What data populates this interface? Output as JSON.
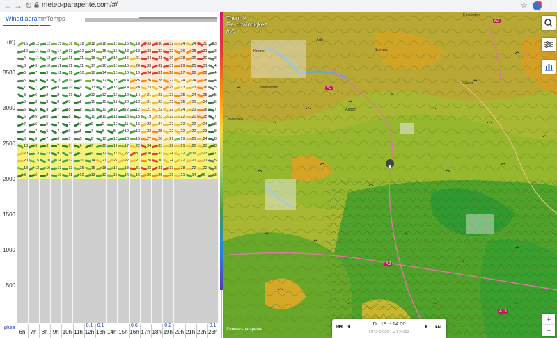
{
  "browser": {
    "url": "meteo-parapente.com/#/"
  },
  "tabs": [
    {
      "label": "Winddiagramm"
    },
    {
      "label": "Temps"
    }
  ],
  "yaxis": {
    "unit": "(m)",
    "labels": [
      "3500",
      "3000",
      "2500",
      "2000",
      "1500",
      "1000",
      "500"
    ]
  },
  "hours": [
    "6h",
    "7h",
    "8h",
    "9h",
    "10h",
    "11h",
    "12h",
    "13h",
    "14h",
    "15h",
    "16h",
    "17h",
    "18h",
    "19h",
    "20h",
    "21h",
    "22h",
    "23h"
  ],
  "rain": {
    "label": "pluie",
    "values": [
      "",
      "",
      "",
      "",
      "",
      "",
      "0.1",
      "0.1",
      "",
      "",
      "0.6",
      "",
      "",
      "0.2",
      "",
      "",
      "",
      "0.1"
    ]
  },
  "speed_rows": [
    [
      "16",
      "12",
      "12",
      "15",
      "18",
      "18",
      "18",
      "18",
      "16",
      "15",
      "18",
      "33",
      "30",
      "32",
      "24",
      "24",
      "30",
      "3"
    ],
    [
      "12",
      "11",
      "12",
      "14",
      "13",
      "12",
      "14",
      "15",
      "16",
      "13",
      "18",
      "33",
      "32",
      "32",
      "26",
      "28",
      "31",
      "3"
    ],
    [
      "4",
      "11",
      "12",
      "12",
      "15",
      "11",
      "18",
      "17",
      "14",
      "16",
      "21",
      "34",
      "31",
      "30",
      "28",
      "26",
      "30",
      "3"
    ],
    [
      "3",
      "9",
      "10",
      "11",
      "11",
      "11",
      "17",
      "16",
      "15",
      "15",
      "20",
      "33",
      "32",
      "31",
      "29",
      "25",
      "31",
      "4"
    ],
    [
      "6",
      "7",
      "9",
      "11",
      "11",
      "10",
      "16",
      "14",
      "15",
      "16",
      "19",
      "34",
      "31",
      "28",
      "27",
      "26",
      "29",
      "4"
    ],
    [
      "5",
      "8",
      "8",
      "10",
      "10",
      "9",
      "16",
      "12",
      "13",
      "14",
      "25",
      "26",
      "28",
      "27",
      "24",
      "24",
      "28",
      "4"
    ],
    [
      "7",
      "7",
      "9",
      "9",
      "10",
      "9",
      "13",
      "11",
      "13",
      "14",
      "20",
      "23",
      "24",
      "25",
      "23",
      "23",
      "26",
      "5"
    ],
    [
      "8",
      "6",
      "9",
      "8",
      "10",
      "8",
      "12",
      "12",
      "12",
      "12",
      "14",
      "21",
      "23",
      "23",
      "25",
      "24",
      "25",
      "5"
    ],
    [
      "9",
      "8",
      "8",
      "9",
      "9",
      "8",
      "11",
      "11",
      "11",
      "12",
      "12",
      "21",
      "22",
      "23",
      "25",
      "21",
      "24",
      "6"
    ],
    [
      "5",
      "6",
      "8",
      "7",
      "8",
      "8",
      "11",
      "11",
      "12",
      "12",
      "12",
      "21",
      "22",
      "22",
      "24",
      "21",
      "26",
      "7"
    ],
    [
      "6",
      "5",
      "5",
      "7",
      "8",
      "7",
      "10",
      "11",
      "11",
      "13",
      "15",
      "19",
      "23",
      "22",
      "22",
      "20",
      "25",
      "7"
    ],
    [
      "7",
      "6",
      "6",
      "7",
      "7",
      "7",
      "9",
      "9",
      "10",
      "11",
      "16",
      "22",
      "24",
      "22",
      "22",
      "22",
      "24",
      "8"
    ],
    [
      "7",
      "7",
      "6",
      "7",
      "6",
      "5",
      "7",
      "8",
      "8",
      "10",
      "13",
      "23",
      "25",
      "22",
      "22",
      "22",
      "23",
      "8"
    ],
    [
      "6",
      "6",
      "7",
      "6",
      "5",
      "5",
      "6",
      "10",
      "10",
      "10",
      "15",
      "27",
      "26",
      "21",
      "19",
      "21",
      "24",
      "8"
    ],
    [
      "13",
      "9",
      "9",
      "7",
      "7",
      "6",
      "7",
      "10",
      "12",
      "17",
      "22",
      "34",
      "33",
      "22",
      "21",
      "20",
      "23",
      "8"
    ],
    [
      "20",
      "13",
      "12",
      "9",
      "10",
      "7",
      "9",
      "12",
      "16",
      "22",
      "31",
      "30",
      "33",
      "24",
      "22",
      "19",
      "23",
      "7"
    ],
    [
      "20",
      "15",
      "10",
      "14",
      "12",
      "10",
      "14",
      "21",
      "22",
      "22",
      "21",
      "28",
      "30",
      "24",
      "22",
      "21",
      "21",
      "5"
    ],
    [
      "18",
      "13",
      "10",
      "13",
      "13",
      "15",
      "15",
      "18",
      "16",
      "18",
      "31",
      "33",
      "31",
      "33",
      "28",
      "22",
      "22",
      "3"
    ],
    [
      "8",
      "6",
      "8",
      "10",
      "11",
      "10",
      "13",
      "12",
      "15",
      "14",
      "16",
      "26",
      "26",
      "26",
      "21",
      "14",
      "6",
      "3"
    ]
  ],
  "map": {
    "title_line1": "Thermik",
    "title_line2": "Geschwindigkeit",
    "unit": "m/s",
    "time_label": "Di. 18. - 14:00",
    "time_sub": "UTC+02:00 – ⌀ 17h16Z",
    "roads": [
      "A3",
      "A2",
      "A2",
      "A13"
    ],
    "places": [
      "Einsiedeln",
      "Schwyz",
      "Glarus",
      "Altdorf",
      "Nidwalden",
      "Obwalden",
      "Kriens",
      "Arth"
    ],
    "attribution": "© meteo-parapente"
  }
}
